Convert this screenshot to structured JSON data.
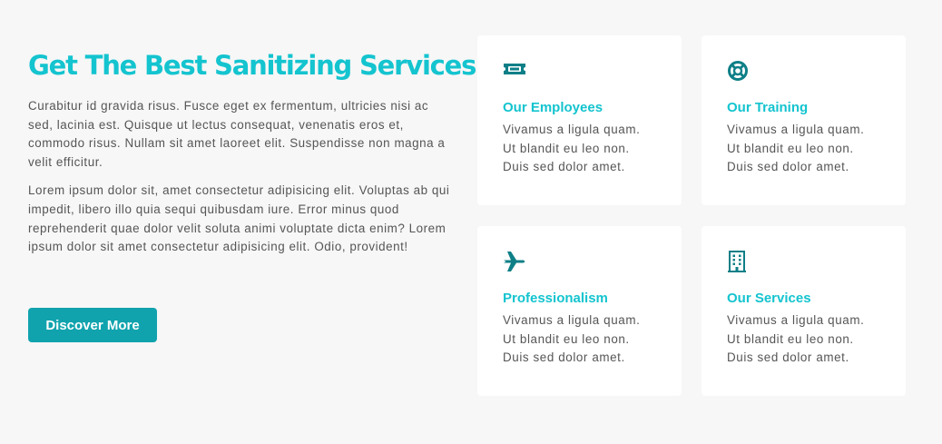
{
  "intro": {
    "title": "Get The Best Sanitizing Services",
    "paragraphs": [
      "Curabitur id gravida risus. Fusce eget ex fermentum, ultricies nisi ac sed, lacinia est. Quisque ut lectus consequat, venenatis eros et, commodo risus. Nullam sit amet laoreet elit. Suspendisse non magna a velit efficitur.",
      "Lorem ipsum dolor sit, amet consectetur adipisicing elit. Voluptas ab qui impedit, libero illo quia sequi quibusdam iure. Error minus quod reprehenderit quae dolor velit soluta animi voluptate dicta enim? Lorem ipsum dolor sit amet consectetur adipisicing elit. Odio, provident!"
    ],
    "button_label": "Discover More"
  },
  "accent_color": "#14c4cf",
  "icon_color": "#0e7f87",
  "button_color": "#10a3ae",
  "cards": [
    {
      "icon": "ticket-icon",
      "title": "Our Employees",
      "lines": [
        "Vivamus a ligula quam.",
        "Ut blandit eu leo non.",
        "Duis sed dolor amet."
      ]
    },
    {
      "icon": "life-ring-icon",
      "title": "Our Training",
      "lines": [
        "Vivamus a ligula quam.",
        "Ut blandit eu leo non.",
        "Duis sed dolor amet."
      ]
    },
    {
      "icon": "plane-icon",
      "title": "Professionalism",
      "lines": [
        "Vivamus a ligula quam.",
        "Ut blandit eu leo non.",
        "Duis sed dolor amet."
      ]
    },
    {
      "icon": "building-icon",
      "title": "Our Services",
      "lines": [
        "Vivamus a ligula quam.",
        "Ut blandit eu leo non.",
        "Duis sed dolor amet."
      ]
    }
  ]
}
